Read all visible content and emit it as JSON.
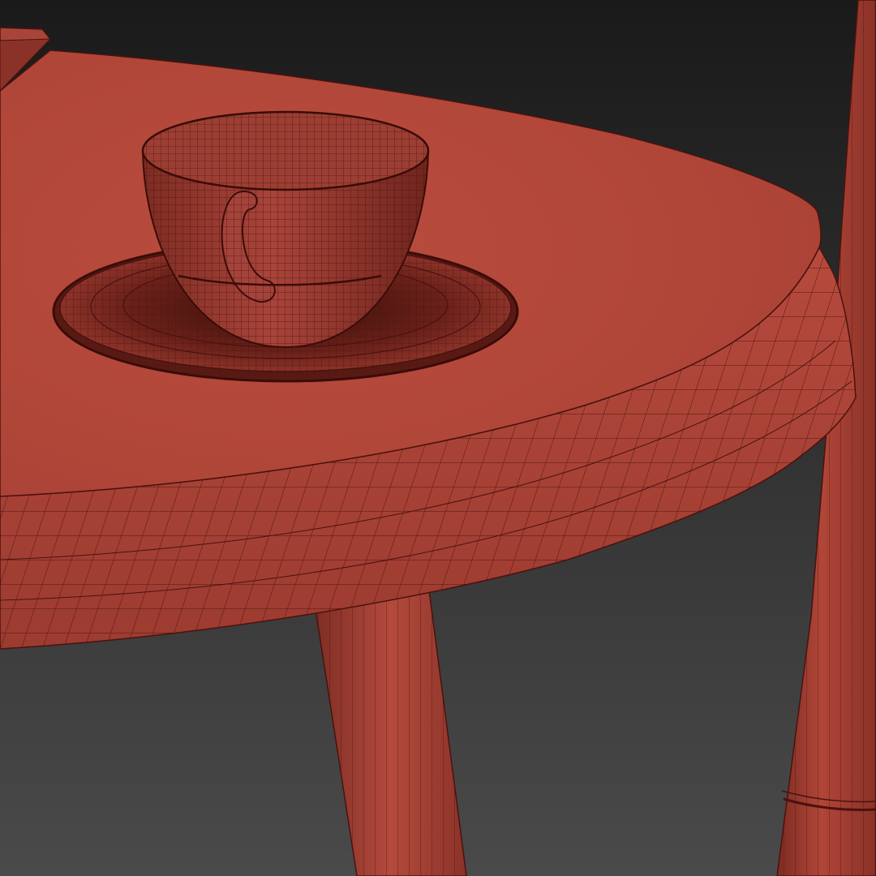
{
  "viewport": {
    "background_top": "#1a1a1a",
    "background_bottom": "#4a4a4a"
  },
  "material": {
    "base": "#b0473c",
    "light": "#c25446",
    "dark": "#7a2a22",
    "wire": "#4a120e"
  },
  "scene_objects": [
    "book-corner",
    "table-top",
    "table-edge",
    "table-leg-front",
    "chair-leg",
    "saucer",
    "cup"
  ]
}
